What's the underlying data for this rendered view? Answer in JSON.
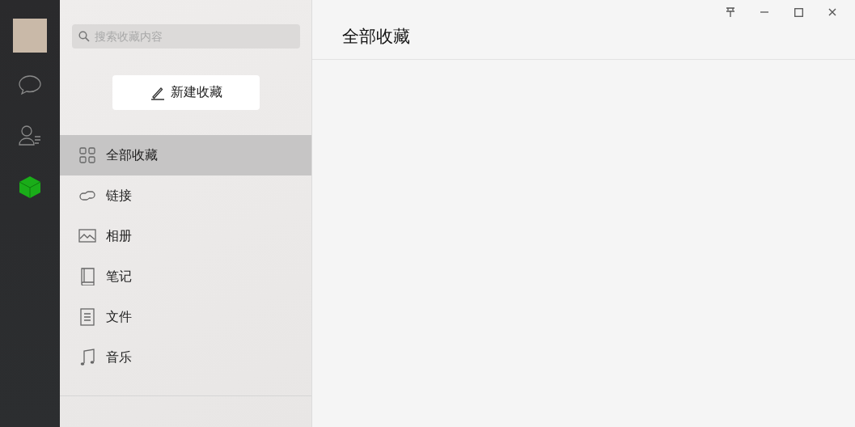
{
  "nav": [
    {
      "kind": "chat",
      "selected": false
    },
    {
      "kind": "contacts",
      "selected": false
    },
    {
      "kind": "favorites",
      "selected": true
    }
  ],
  "search": {
    "placeholder": "搜索收藏内容"
  },
  "new_button": "新建收藏",
  "categories": [
    {
      "kind": "all",
      "label": "全部收藏",
      "selected": true
    },
    {
      "kind": "link",
      "label": "链接",
      "selected": false
    },
    {
      "kind": "album",
      "label": "相册",
      "selected": false
    },
    {
      "kind": "note",
      "label": "笔记",
      "selected": false
    },
    {
      "kind": "file",
      "label": "文件",
      "selected": false
    },
    {
      "kind": "music",
      "label": "音乐",
      "selected": false
    }
  ],
  "main": {
    "title": "全部收藏"
  }
}
